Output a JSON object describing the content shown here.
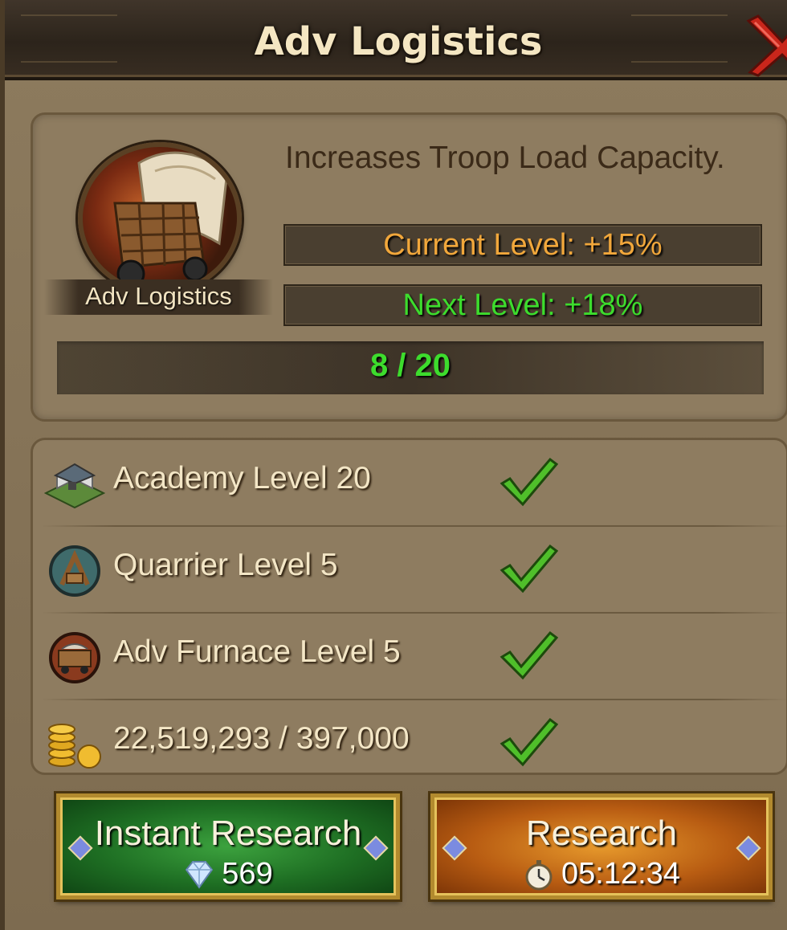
{
  "header": {
    "title": "Adv Logistics",
    "close_icon": "close-x-icon"
  },
  "tech": {
    "icon_name": "supply-wagon-icon",
    "label": "Adv Logistics",
    "description": "Increases Troop Load Capacity.",
    "current_level": "Current Level: +15%",
    "next_level": "Next Level: +18%",
    "progress_text": "8 / 20",
    "progress_fraction": 0.4
  },
  "requirements": [
    {
      "icon": "academy-building-icon",
      "text": "Academy Level 20",
      "met": true,
      "status_icon": "checkmark-icon"
    },
    {
      "icon": "quarrier-icon",
      "text": "Quarrier Level 5",
      "met": true,
      "status_icon": "checkmark-icon"
    },
    {
      "icon": "adv-furnace-icon",
      "text": "Adv Furnace Level 5",
      "met": true,
      "status_icon": "checkmark-icon"
    },
    {
      "icon": "gold-coins-icon",
      "text": "22,519,293 / 397,000",
      "met": true,
      "status_icon": "checkmark-icon"
    }
  ],
  "actions": {
    "instant": {
      "label": "Instant Research",
      "cost": "569",
      "cost_icon": "gem-icon"
    },
    "research": {
      "label": "Research",
      "time": "05:12:34",
      "time_icon": "stopwatch-icon"
    }
  },
  "colors": {
    "current_level": "#f1a73b",
    "next_level": "#3ddc2d",
    "instant_button": "#1e6e23",
    "research_button": "#b85c12"
  }
}
